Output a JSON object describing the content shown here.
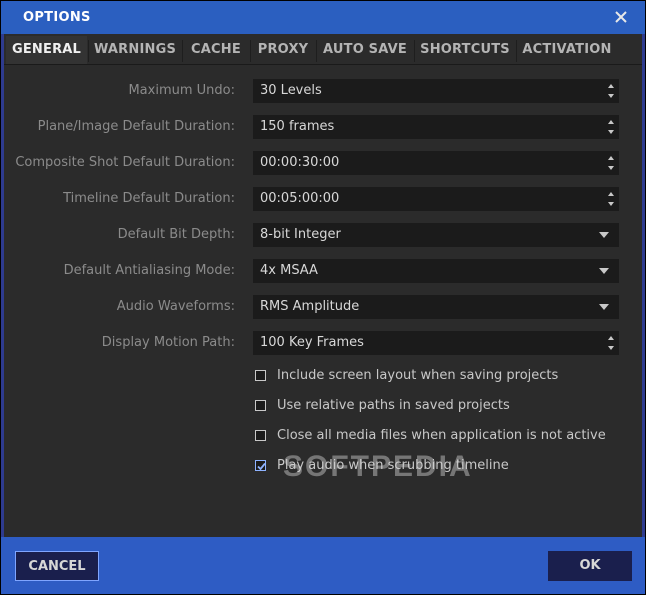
{
  "window": {
    "title": "OPTIONS"
  },
  "tabs": [
    {
      "label": "GENERAL"
    },
    {
      "label": "WARNINGS"
    },
    {
      "label": "CACHE"
    },
    {
      "label": "PROXY"
    },
    {
      "label": "AUTO SAVE"
    },
    {
      "label": "SHORTCUTS"
    },
    {
      "label": "ACTIVATION"
    }
  ],
  "settings": [
    {
      "label": "Maximum Undo:",
      "value": "30 Levels",
      "control": "spinner"
    },
    {
      "label": "Plane/Image Default Duration:",
      "value": "150 frames",
      "control": "spinner"
    },
    {
      "label": "Composite Shot Default Duration:",
      "value": "00:00:30:00",
      "control": "spinner"
    },
    {
      "label": "Timeline Default Duration:",
      "value": "00:05:00:00",
      "control": "spinner"
    },
    {
      "label": "Default Bit Depth:",
      "value": "8-bit Integer",
      "control": "dropdown"
    },
    {
      "label": "Default Antialiasing Mode:",
      "value": "4x MSAA",
      "control": "dropdown"
    },
    {
      "label": "Audio Waveforms:",
      "value": "RMS Amplitude",
      "control": "dropdown"
    },
    {
      "label": "Display Motion Path:",
      "value": "100 Key Frames",
      "control": "spinner"
    }
  ],
  "checkboxes": [
    {
      "label": "Include screen layout when saving projects",
      "checked": false
    },
    {
      "label": "Use relative paths in saved projects",
      "checked": false
    },
    {
      "label": "Close all media files when application is not active",
      "checked": false
    },
    {
      "label": "Play audio when scrubbing timeline",
      "checked": true
    }
  ],
  "watermark": "SOFTPEDIA",
  "footer": {
    "cancel_label": "CANCEL",
    "ok_label": "OK"
  }
}
